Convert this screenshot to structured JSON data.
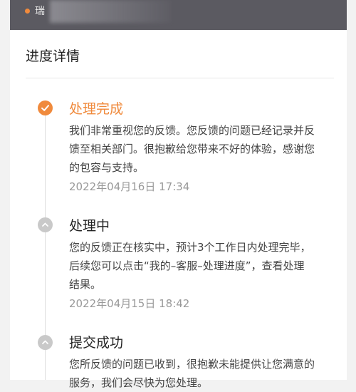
{
  "top": {
    "text": "瑞"
  },
  "progress": {
    "title": "进度详情",
    "steps": [
      {
        "title": "处理完成",
        "desc": "我们非常重视您的反馈。您反馈的问题已经记录并反馈至相关部门。很抱歉给您带来不好的体验，感谢您的包容与支持。",
        "time": "2022年04月16日 17:34",
        "icon": "check-circle-icon",
        "status": "done"
      },
      {
        "title": "处理中",
        "desc": "您的反馈正在核实中，预计3个工作日内处理完毕，后续您可以点击“我的–客服–处理进度”，查看处理结果。",
        "time": "2022年04月15日 18:42",
        "icon": "chevron-up-circle-icon",
        "status": "pending"
      },
      {
        "title": "提交成功",
        "desc": "您所反馈的问题已收到，很抱歉未能提供让您满意的服务，我们会尽快为您处理。",
        "icon": "chevron-up-circle-icon",
        "status": "pending"
      }
    ]
  },
  "colors": {
    "accent": "#f08a3c",
    "inactive": "#c9c9c9"
  }
}
